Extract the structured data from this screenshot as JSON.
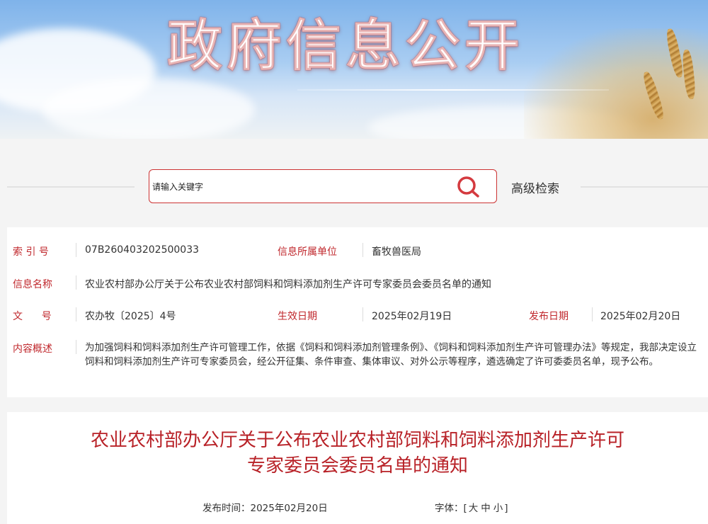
{
  "banner": {
    "title": "政府信息公开"
  },
  "search": {
    "placeholder": "请输入关键字",
    "advanced_label": "高级检索"
  },
  "info": {
    "index_label": "索 引 号",
    "index_value": "07B260403202500033",
    "unit_label": "信息所属单位",
    "unit_value": "畜牧兽医局",
    "name_label": "信息名称",
    "name_value": "农业农村部办公厅关于公布农业农村部饲料和饲料添加剂生产许可专家委员会委员名单的通知",
    "doc_label": "文      号",
    "doc_value": "农办牧〔2025〕4号",
    "effective_label": "生效日期",
    "effective_value": "2025年02月19日",
    "publish_label": "发布日期",
    "publish_value": "2025年02月20日",
    "summary_label": "内容概述",
    "summary_value": "为加强饲料和饲料添加剂生产许可管理工作，依据《饲料和饲料添加剂管理条例》、《饲料和饲料添加剂生产许可管理办法》等规定，我部决定设立饲料和饲料添加剂生产许可专家委员会，经公开征集、条件审查、集体审议、对外公示等程序，遴选确定了许可委委员名单，现予公布。"
  },
  "article": {
    "title_line1": "农业农村部办公厅关于公布农业农村部饲料和饲料添加剂生产许可",
    "title_line2": "专家委员会委员名单的通知",
    "publish_time": "发布时间：2025年02月20日",
    "font_label": "字体：",
    "font_open": "[",
    "font_large": "大",
    "font_medium": "中",
    "font_small": "小",
    "font_close": "]"
  },
  "colors": {
    "accent_red": "#c0282d",
    "title_red": "#b82127",
    "search_border": "#cc3333"
  }
}
